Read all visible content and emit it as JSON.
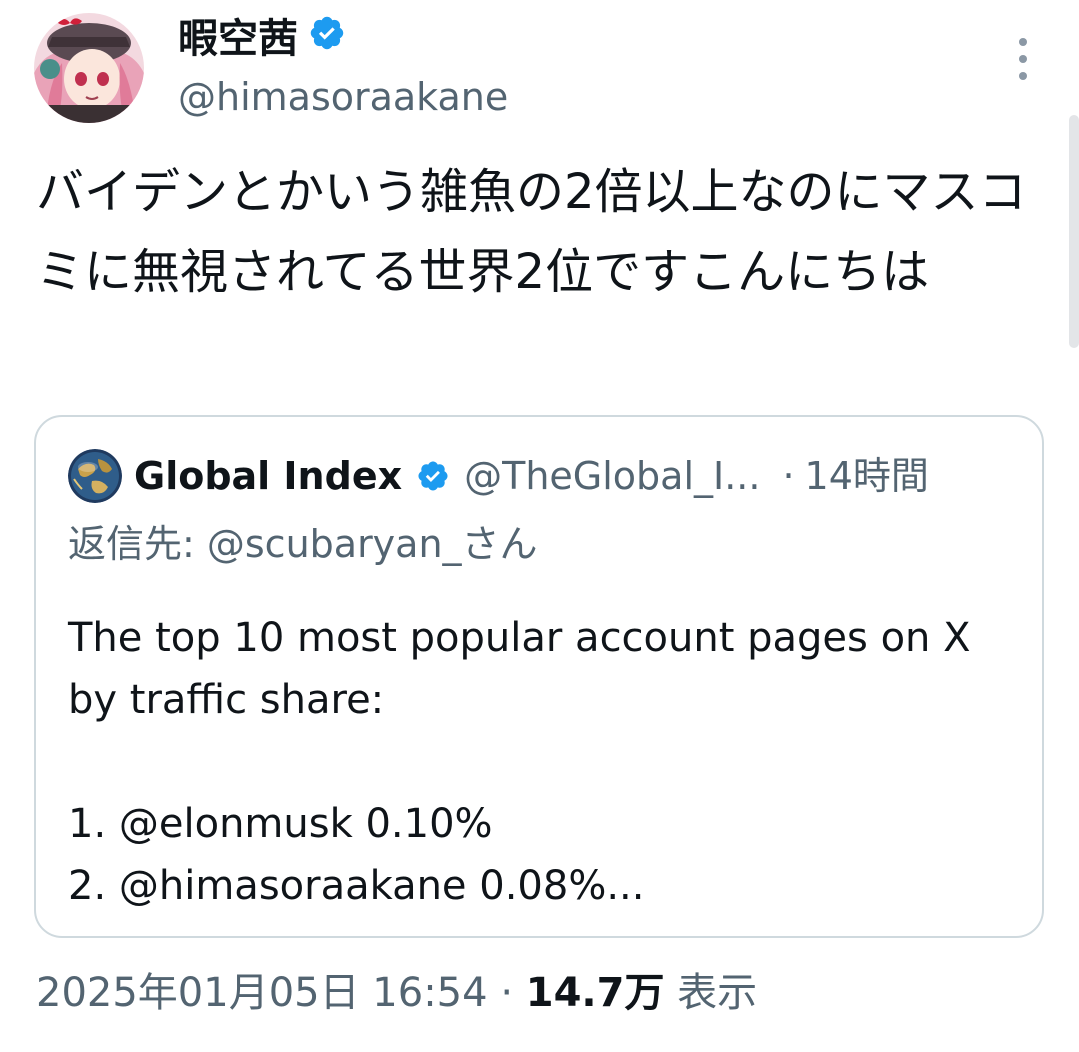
{
  "author": {
    "display_name": "暇空茜",
    "handle": "@himasoraakane",
    "verified": true
  },
  "tweet": {
    "text": "バイデンとかいう雑魚の2倍以上なのにマスコミに無視されてる世界2位ですこんにちは"
  },
  "quote": {
    "display_name": "Global Index",
    "verified": true,
    "handle": "@TheGlobal_I...",
    "separator": "·",
    "time": "14時間",
    "reply_to": "返信先: @scubaryan_さん",
    "body": "The top 10 most popular account pages on X by traffic share:\n\n1. @elonmusk 0.10%\n2. @himasoraakane 0.08%..."
  },
  "meta": {
    "timestamp": "2025年01月05日 16:54",
    "separator": "·",
    "views_count": "14.7万",
    "views_label": "表示"
  },
  "colors": {
    "text_primary": "#0f1419",
    "text_secondary": "#536471",
    "verified_blue": "#1d9bf0",
    "border": "#cfd9de"
  },
  "icons": {
    "verified": "verified-badge-icon",
    "more": "more-options-icon"
  }
}
